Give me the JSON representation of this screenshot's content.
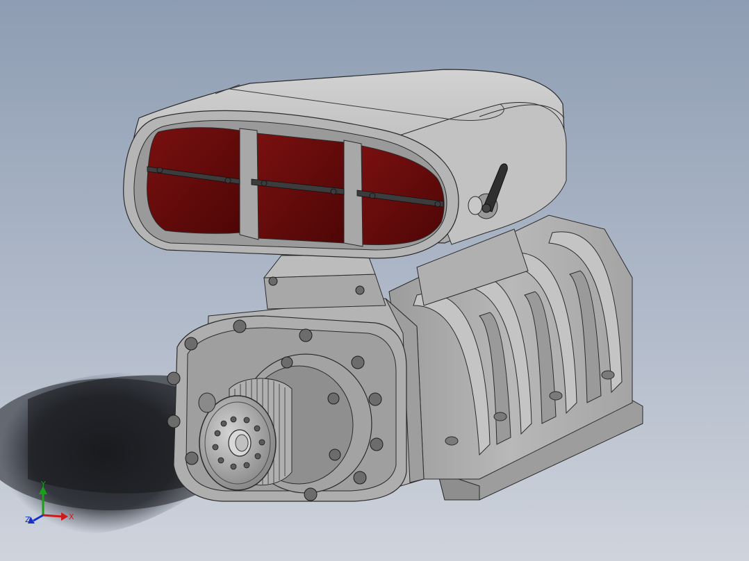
{
  "viewport": {
    "background_top": "#8e9db3",
    "background_bottom": "#c8ced8",
    "model_body_color": "#b8b8b8",
    "model_edge_color": "#2a2a2a",
    "scoop_screen_color": "#6b0b0b",
    "shadow_color": "#1a1c20"
  },
  "triad": {
    "x_label": "X",
    "y_label": "Y",
    "z_label": "Z",
    "x_color": "#d01818",
    "y_color": "#18a018",
    "z_color": "#1830c8"
  },
  "model": {
    "name_icon": "supercharger-blower-3d-model",
    "pulley_icon": "gear-pulley-icon",
    "throttle_lever_icon": "lever-icon"
  }
}
